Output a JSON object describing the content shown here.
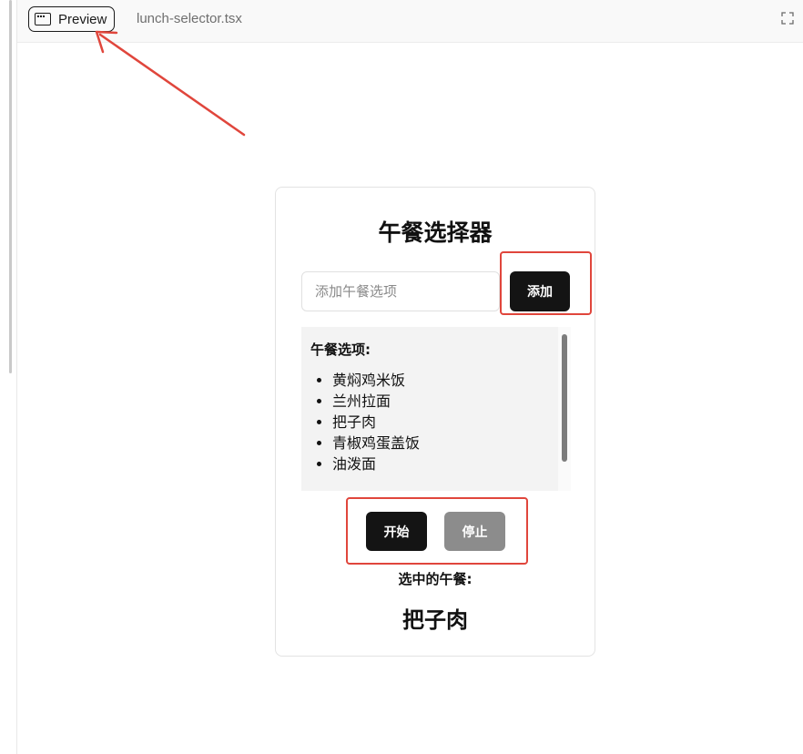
{
  "topbar": {
    "preview_label": "Preview",
    "preview_icon": "browser-window-icon",
    "filename": "lunch-selector.tsx",
    "expand_icon": "expand-icon"
  },
  "app": {
    "title": "午餐选择器",
    "input_placeholder": "添加午餐选项",
    "input_value": "",
    "add_label": "添加",
    "options_title": "午餐选项:",
    "options": [
      "黄焖鸡米饭",
      "兰州拉面",
      "把子肉",
      "青椒鸡蛋盖饭",
      "油泼面"
    ],
    "start_label": "开始",
    "stop_label": "停止",
    "selected_label": "选中的午餐:",
    "selected_value": "把子肉"
  },
  "annotations": {
    "highlight_color": "#e0463c"
  },
  "colors": {
    "primary_button": "#141414",
    "disabled_button": "#8c8c8c",
    "list_background": "#f3f3f3"
  }
}
